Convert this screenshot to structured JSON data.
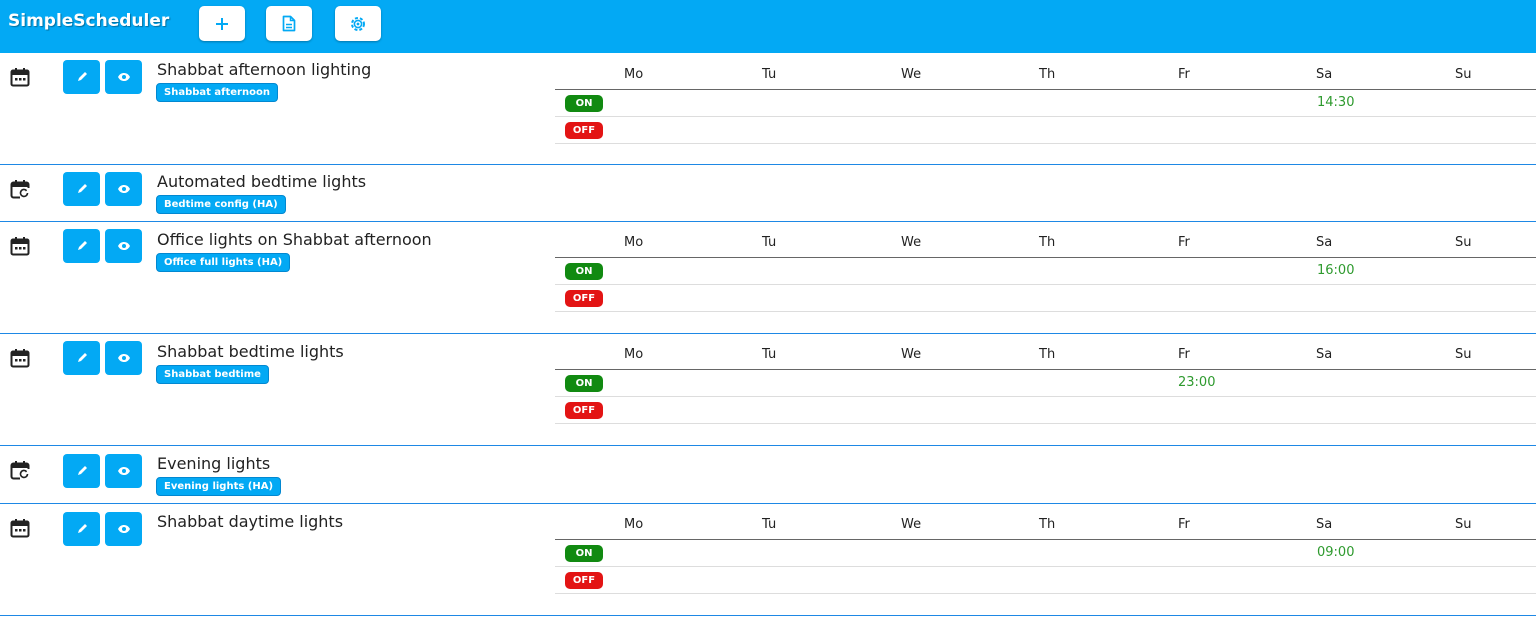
{
  "app": {
    "title": "SimpleScheduler"
  },
  "toolbar": {
    "add_icon": "plus-icon",
    "file_icon": "file-icon",
    "settings_icon": "gear-icon"
  },
  "days": [
    "Mo",
    "Tu",
    "We",
    "Th",
    "Fr",
    "Sa",
    "Su"
  ],
  "labels": {
    "on": "ON",
    "off": "OFF"
  },
  "schedules": [
    {
      "name": "Shabbat afternoon lighting",
      "tag": "Shabbat afternoon",
      "on_time": "14:30"
    },
    {
      "name": "Automated bedtime lights",
      "tag": "Bedtime config (HA)"
    },
    {
      "name": "Office lights on Shabbat afternoon",
      "tag": "Office full lights (HA)",
      "on_time": "16:00"
    },
    {
      "name": "Shabbat bedtime lights",
      "tag": "Shabbat bedtime",
      "on_time": "23:00"
    },
    {
      "name": "Evening lights",
      "tag": "Evening lights (HA)"
    },
    {
      "name": "Shabbat daytime lights",
      "tag": "Shabbat daytime",
      "on_time": "09:00"
    }
  ],
  "colors": {
    "accent": "#03a9f4",
    "on": "#118a11",
    "off": "#e31414",
    "time": "#2e9a2e"
  }
}
